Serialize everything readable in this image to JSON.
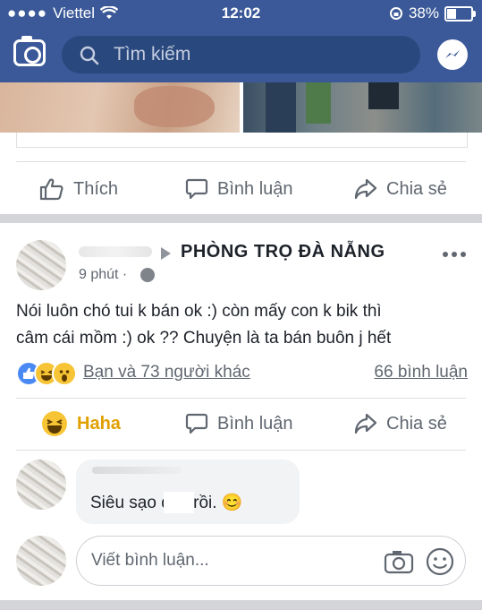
{
  "status_bar": {
    "carrier": "Viettel",
    "time": "12:02",
    "battery": "38%"
  },
  "nav": {
    "search_placeholder": "Tìm kiếm"
  },
  "prev_post_actions": {
    "like": "Thích",
    "comment": "Bình luận",
    "share": "Chia sẻ"
  },
  "post": {
    "group": "PHÒNG TRỌ ĐÀ NẴNG",
    "time": "9 phút ·",
    "text_line1": "Nói luôn chó tui k bán ok :) còn mấy con        k bik thì",
    "text_line2": "câm cái mồm :) ok ?? Chuyện là ta         bán buôn j hết",
    "reactions_summary": "Bạn và 73 người khác",
    "comment_count": "66 bình luận",
    "actions": {
      "reaction": "Haha",
      "comment": "Bình luận",
      "share": "Chia sẻ"
    },
    "reaction_colors": {
      "like": "#4a89f3",
      "haha": "#f7c435"
    },
    "accent_reaction": "#e0a000"
  },
  "comment": {
    "text": "Siêu sạo         đây rồi. 😊"
  },
  "composer": {
    "placeholder": "Viết bình luận..."
  },
  "colors": {
    "brand": "#3b5998"
  }
}
